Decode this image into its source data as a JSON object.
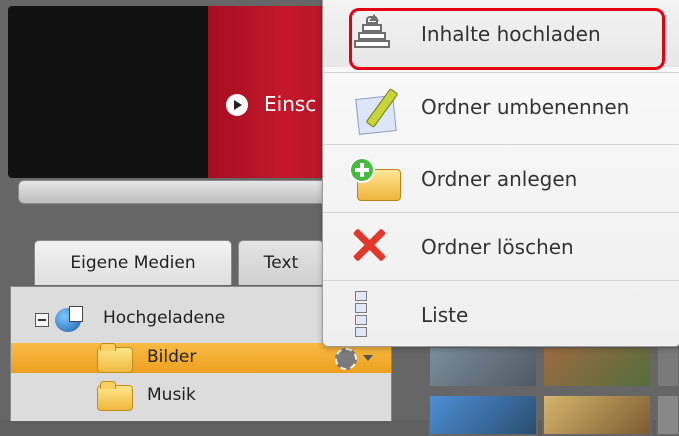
{
  "media_panel": {
    "video_link_text": "Einsc",
    "tabs": [
      {
        "label": "Eigene Medien"
      },
      {
        "label": "Text"
      }
    ],
    "tree": [
      {
        "label": "Hochgeladene"
      },
      {
        "label": "Bilder"
      },
      {
        "label": "Musik"
      }
    ]
  },
  "context_menu": {
    "items": [
      {
        "label": "Inhalte hochladen",
        "icon": "upload-icon"
      },
      {
        "label": "Ordner umbenennen",
        "icon": "rename-icon"
      },
      {
        "label": "Ordner anlegen",
        "icon": "folder-add-icon"
      },
      {
        "label": "Ordner löschen",
        "icon": "delete-icon"
      },
      {
        "label": "Liste",
        "icon": "list-icon"
      }
    ]
  },
  "colors": {
    "highlight_border": "#e60012",
    "selected_row": "#f3a72c",
    "video_red": "#b2142a"
  }
}
